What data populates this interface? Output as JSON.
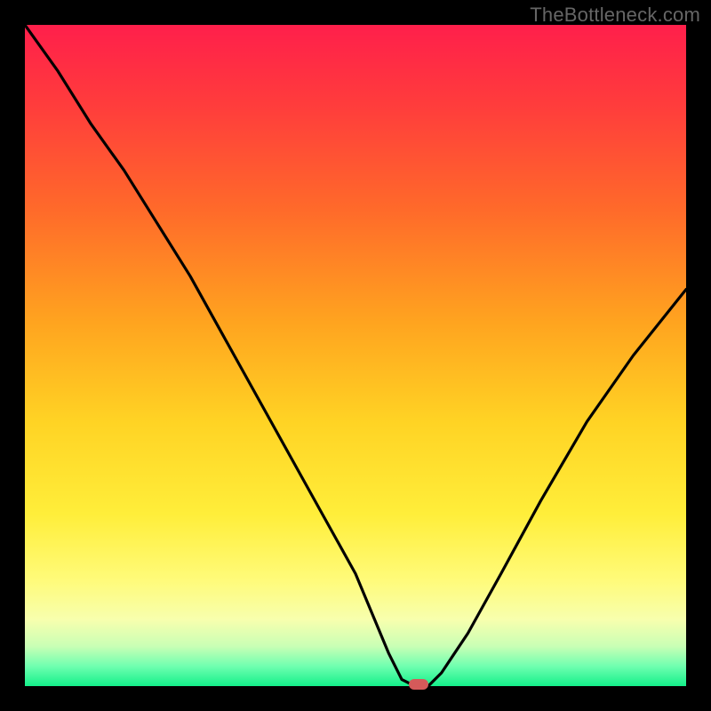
{
  "watermark": "TheBottleneck.com",
  "colors": {
    "page_bg": "#000000",
    "watermark_text": "#666666",
    "curve_stroke": "#000000",
    "marker_fill": "#d55a5a",
    "gradient_top": "#ff1f4b",
    "gradient_bottom": "#14f08a"
  },
  "chart_data": {
    "type": "line",
    "title": "",
    "xlabel": "",
    "ylabel": "",
    "xlim": [
      0,
      100
    ],
    "ylim": [
      0,
      100
    ],
    "grid": false,
    "legend": false,
    "annotations": [
      {
        "text": "TheBottleneck.com",
        "position": "top-right"
      }
    ],
    "marker": {
      "x": 59.5,
      "y": 0,
      "shape": "pill",
      "color": "#d55a5a"
    },
    "series": [
      {
        "name": "bottleneck-curve",
        "type": "line",
        "x": [
          0,
          5,
          10,
          15,
          20,
          25,
          30,
          35,
          40,
          45,
          50,
          55,
          57,
          59,
          61,
          63,
          67,
          72,
          78,
          85,
          92,
          100
        ],
        "y": [
          100,
          93,
          85,
          78,
          70,
          62,
          53,
          44,
          35,
          26,
          17,
          5,
          1,
          0,
          0,
          2,
          8,
          17,
          28,
          40,
          50,
          60
        ]
      }
    ],
    "notes": "x is horizontal position as percent of plot width (0=left). y is vertical position as percent of plot height (0=baseline/bottom, 100=top). Sharp V-shaped curve with minimum around x≈59–61, steeper left branch, shallower right branch."
  }
}
